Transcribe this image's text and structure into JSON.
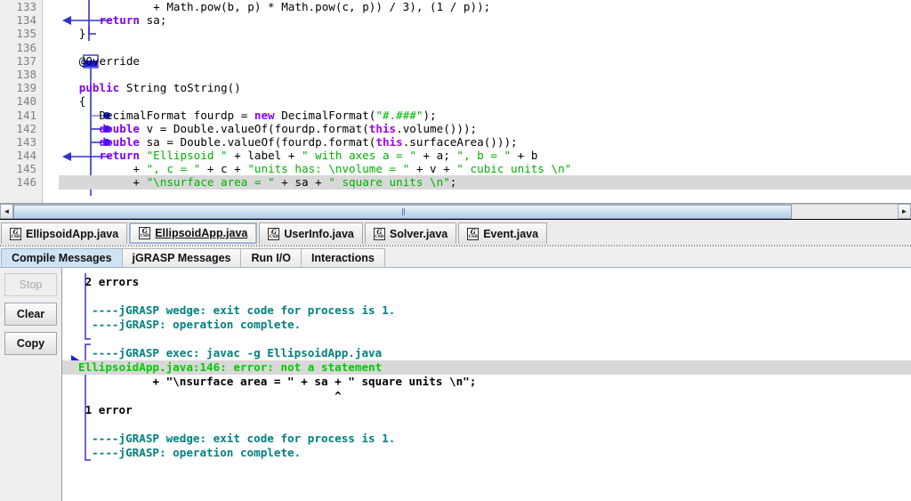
{
  "app": {
    "name": "jGRASP",
    "icon": "jgrasp-csd-icon"
  },
  "editor": {
    "first_line": 133,
    "lines": [
      {
        "num": "133",
        "segments": [
          {
            "t": "              + Math.pow(b, p) * Math.pow(c, p)) / 3), (1 / p));",
            "c": "plain"
          }
        ]
      },
      {
        "num": "134",
        "segments": [
          {
            "t": "      ",
            "c": "plain"
          },
          {
            "t": "return",
            "c": "kw"
          },
          {
            "t": " sa;",
            "c": "plain"
          }
        ]
      },
      {
        "num": "135",
        "segments": [
          {
            "t": "   }",
            "c": "plain"
          }
        ]
      },
      {
        "num": "136",
        "segments": [
          {
            "t": "",
            "c": "plain"
          }
        ]
      },
      {
        "num": "137",
        "segments": [
          {
            "t": "   @Override",
            "c": "plain"
          }
        ]
      },
      {
        "num": "138",
        "segments": [
          {
            "t": "",
            "c": "plain"
          }
        ]
      },
      {
        "num": "139",
        "segments": [
          {
            "t": "   ",
            "c": "plain"
          },
          {
            "t": "public",
            "c": "kw"
          },
          {
            "t": " String toString()",
            "c": "plain"
          }
        ]
      },
      {
        "num": "140",
        "segments": [
          {
            "t": "   {",
            "c": "plain"
          }
        ]
      },
      {
        "num": "141",
        "segments": [
          {
            "t": "      DecimalFormat fourdp = ",
            "c": "plain"
          },
          {
            "t": "new",
            "c": "kw"
          },
          {
            "t": " DecimalFormat(",
            "c": "plain"
          },
          {
            "t": "\"#.###\"",
            "c": "str"
          },
          {
            "t": ");",
            "c": "plain"
          }
        ]
      },
      {
        "num": "142",
        "segments": [
          {
            "t": "      ",
            "c": "plain"
          },
          {
            "t": "double",
            "c": "kw"
          },
          {
            "t": " v = Double.valueOf(fourdp.format(",
            "c": "plain"
          },
          {
            "t": "this",
            "c": "thiskw"
          },
          {
            "t": ".volume()));",
            "c": "plain"
          }
        ]
      },
      {
        "num": "143",
        "segments": [
          {
            "t": "      ",
            "c": "plain"
          },
          {
            "t": "double",
            "c": "kw"
          },
          {
            "t": " sa = Double.valueOf(fourdp.format(",
            "c": "plain"
          },
          {
            "t": "this",
            "c": "thiskw"
          },
          {
            "t": ".surfaceArea()));",
            "c": "plain"
          }
        ]
      },
      {
        "num": "144",
        "segments": [
          {
            "t": "      ",
            "c": "plain"
          },
          {
            "t": "return",
            "c": "kw"
          },
          {
            "t": " ",
            "c": "plain"
          },
          {
            "t": "\"Ellipsoid \"",
            "c": "str"
          },
          {
            "t": " + label + ",
            "c": "plain"
          },
          {
            "t": "\" with axes a = \"",
            "c": "str"
          },
          {
            "t": " + a; ",
            "c": "plain"
          },
          {
            "t": "\", b = \"",
            "c": "str"
          },
          {
            "t": " + b",
            "c": "plain"
          }
        ]
      },
      {
        "num": "145",
        "segments": [
          {
            "t": "           + ",
            "c": "plain"
          },
          {
            "t": "\", c = \"",
            "c": "str"
          },
          {
            "t": " + c + ",
            "c": "plain"
          },
          {
            "t": "\"units has: \\nvolume = \"",
            "c": "str"
          },
          {
            "t": " + v + ",
            "c": "plain"
          },
          {
            "t": "\" cubic units \\n\"",
            "c": "str"
          }
        ]
      },
      {
        "num": "146",
        "highlight": true,
        "segments": [
          {
            "t": "           + ",
            "c": "plain"
          },
          {
            "t": "\"\\nsurface area = \"",
            "c": "str"
          },
          {
            "t": " + sa + ",
            "c": "plain"
          },
          {
            "t": "\" square units \\n\"",
            "c": "str"
          },
          {
            "t": ";",
            "c": "plain"
          }
        ]
      }
    ]
  },
  "hscrollbar": {
    "left_arrow": "◄",
    "right_arrow": "►",
    "thumb_percent": 88
  },
  "file_tabs": [
    {
      "label": "EllipsoidApp.java",
      "active": false
    },
    {
      "label": "EllipsoidApp.java",
      "active": true
    },
    {
      "label": "UserInfo.java",
      "active": false
    },
    {
      "label": "Solver.java",
      "active": false
    },
    {
      "label": "Event.java",
      "active": false
    }
  ],
  "message_tabs": [
    {
      "label": "Compile Messages",
      "active": true
    },
    {
      "label": "jGRASP Messages",
      "active": false
    },
    {
      "label": "Run I/O",
      "active": false
    },
    {
      "label": "Interactions",
      "active": false
    }
  ],
  "output_buttons": [
    {
      "label": "Stop",
      "enabled": false
    },
    {
      "label": "Clear",
      "enabled": true
    },
    {
      "label": "Copy",
      "enabled": true
    }
  ],
  "output_lines": [
    {
      "text": " 2 errors",
      "color": "c-black"
    },
    {
      "text": "",
      "color": "c-black"
    },
    {
      "text": "  ----jGRASP wedge: exit code for process is 1.",
      "color": "c-teal"
    },
    {
      "text": "  ----jGRASP: operation complete.",
      "color": "c-teal"
    },
    {
      "text": "",
      "color": "c-black"
    },
    {
      "text": "  ----jGRASP exec: javac -g EllipsoidApp.java",
      "color": "c-teal"
    },
    {
      "text": "EllipsoidApp.java:146: error: not a statement",
      "color": "c-green",
      "highlight": true,
      "marker": true
    },
    {
      "text": "           + \"\\nsurface area = \" + sa + \" square units \\n\";",
      "color": "c-black"
    },
    {
      "text": "                                      ^",
      "color": "c-black"
    },
    {
      "text": " 1 error",
      "color": "c-black"
    },
    {
      "text": "",
      "color": "c-black"
    },
    {
      "text": "  ----jGRASP wedge: exit code for process is 1.",
      "color": "c-teal"
    },
    {
      "text": "  ----jGRASP: operation complete.",
      "color": "c-teal"
    }
  ],
  "colors": {
    "keyword": "#8000ff",
    "string": "#00b000",
    "error_text": "#00cc00",
    "message_teal": "#00807f",
    "highlight_bg": "#d8d8d8",
    "active_tab_bg": "#cfe3f5",
    "csd_blue": "#2222cc"
  }
}
